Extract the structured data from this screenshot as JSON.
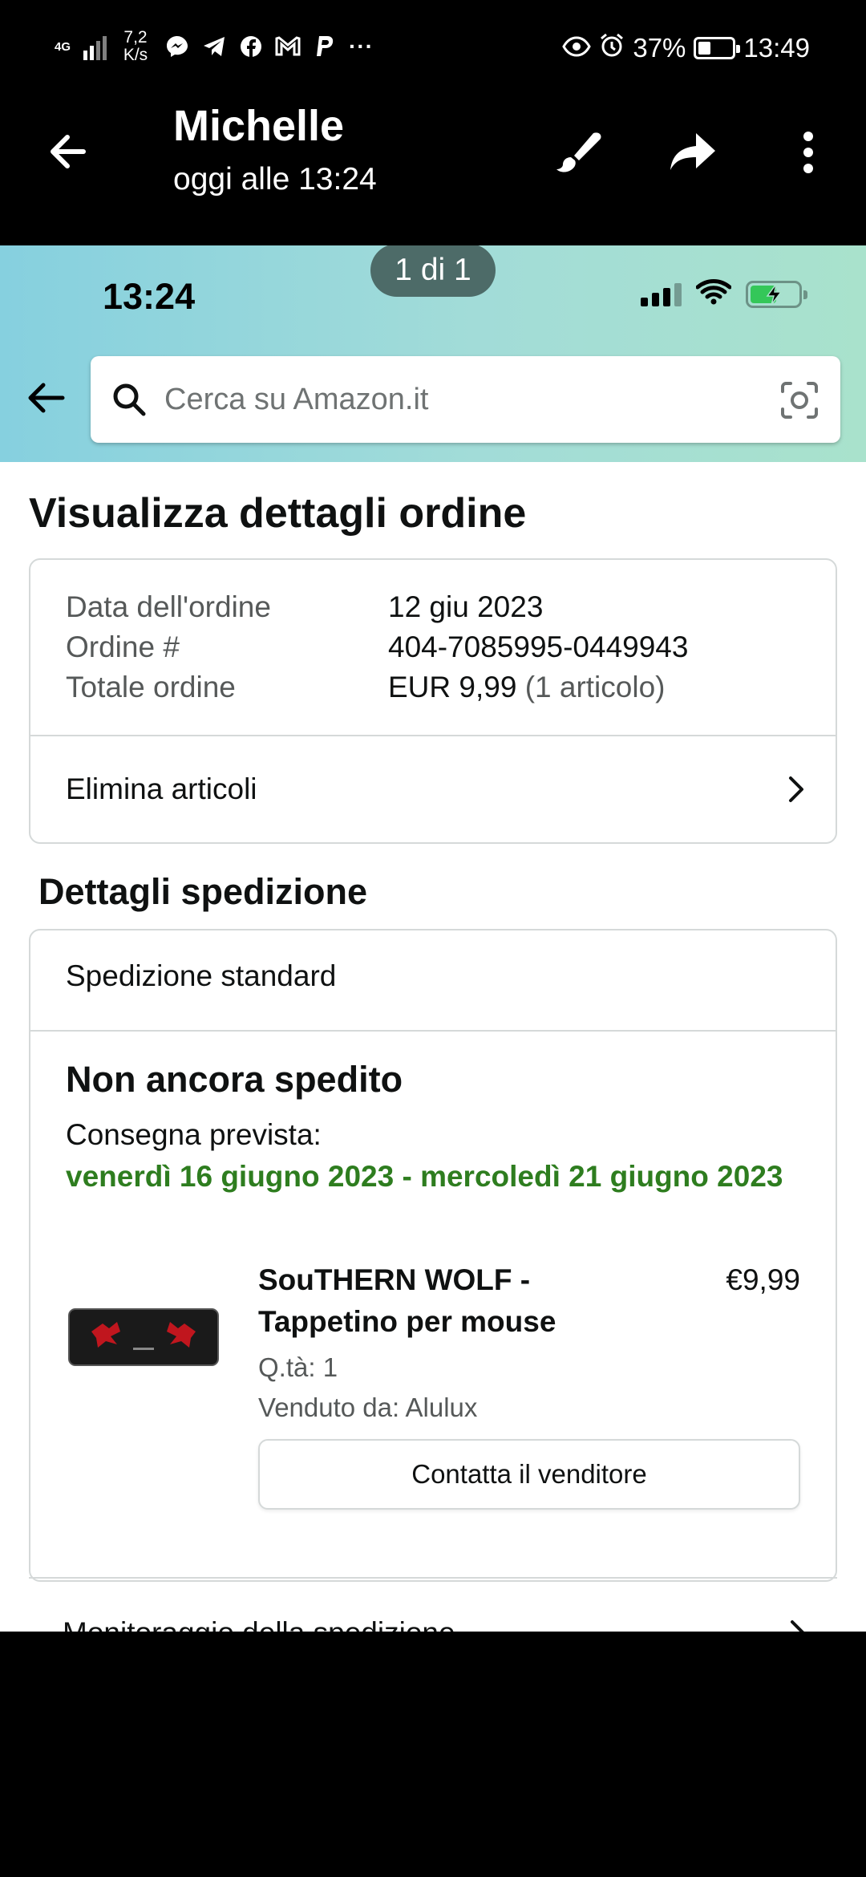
{
  "system_status": {
    "network": "4G",
    "speed": "7,2\nK/s",
    "battery": "37%",
    "battery_level": 0.37,
    "time": "13:49",
    "app_icons": [
      "messenger-icon",
      "telegram-icon",
      "facebook-icon",
      "gmail-icon",
      "paypal-icon"
    ],
    "more": "···"
  },
  "viewer": {
    "title": "Michelle",
    "subtitle": "oggi alle 13:24",
    "page_counter": "1 di 1"
  },
  "screenshot": {
    "ios_time": "13:24",
    "search": {
      "placeholder": "Cerca su Amazon.it"
    },
    "page_title": "Visualizza dettagli ordine",
    "order_summary": {
      "rows": [
        {
          "label": "Data dell'ordine",
          "value": "12 giu 2023"
        },
        {
          "label": "Ordine #",
          "value": "404-7085995-0449943"
        },
        {
          "label": "Totale ordine",
          "value": "EUR 9,99",
          "extra": "(1 articolo)"
        }
      ],
      "delete_items": "Elimina articoli"
    },
    "shipping": {
      "section_title": "Dettagli spedizione",
      "method": "Spedizione standard",
      "status": "Non ancora spedito",
      "delivery_label": "Consegna prevista:",
      "delivery_range": "venerdì 16 giugno 2023 - mercoledì 21 giugno 2023",
      "product": {
        "title": "SouTHERN WOLF - Tappetino per mouse",
        "price": "€9,99",
        "qty": "Q.tà: 1",
        "seller": "Venduto da: Alulux"
      },
      "contact_button": "Contatta il venditore"
    },
    "tracking_row": "Monitoraggio della spedizione"
  },
  "colors": {
    "delivery_green": "#2e7d1f",
    "ios_battery_green": "#34c759",
    "page_counter_bg": "#4d6b68"
  }
}
